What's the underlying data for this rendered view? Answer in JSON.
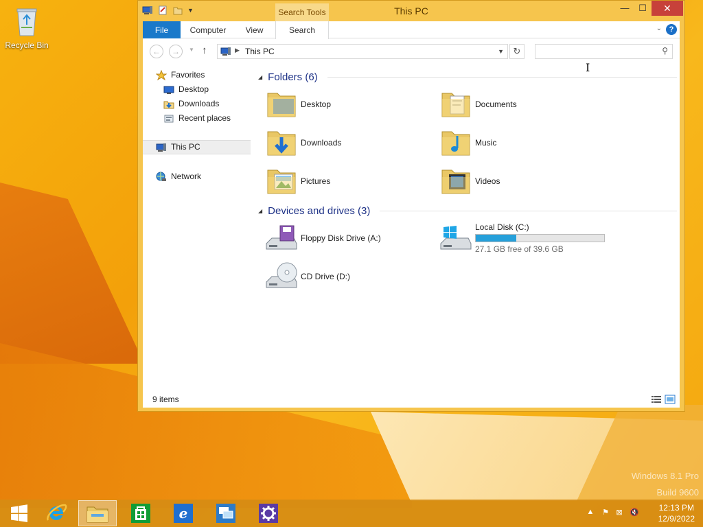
{
  "desktop": {
    "recycle_bin_label": "Recycle Bin",
    "watermark_line1": "Windows 8.1 Pro",
    "watermark_line2": "Build 9600"
  },
  "window": {
    "title": "This PC",
    "contextual_tab": "Search Tools",
    "ribbon_tabs": [
      "File",
      "Computer",
      "View",
      "Search"
    ],
    "address": {
      "path": "This PC"
    },
    "search": {
      "value": "",
      "placeholder": ""
    }
  },
  "navpane": {
    "items": [
      {
        "label": "Favorites",
        "icon": "star-icon"
      },
      {
        "label": "Desktop",
        "icon": "desktop-icon"
      },
      {
        "label": "Downloads",
        "icon": "downloads-icon"
      },
      {
        "label": "Recent places",
        "icon": "recent-places-icon"
      },
      {
        "label": "This PC",
        "icon": "this-pc-icon",
        "selected": true
      },
      {
        "label": "Network",
        "icon": "network-icon"
      }
    ]
  },
  "content": {
    "folders_header": "Folders (6)",
    "folders": [
      {
        "label": "Desktop",
        "icon": "desktop-folder-icon"
      },
      {
        "label": "Documents",
        "icon": "documents-folder-icon"
      },
      {
        "label": "Downloads",
        "icon": "downloads-folder-icon"
      },
      {
        "label": "Music",
        "icon": "music-folder-icon"
      },
      {
        "label": "Pictures",
        "icon": "pictures-folder-icon"
      },
      {
        "label": "Videos",
        "icon": "videos-folder-icon"
      }
    ],
    "drives_header": "Devices and drives (3)",
    "drives": [
      {
        "label": "Floppy Disk Drive (A:)",
        "icon": "floppy-drive-icon"
      },
      {
        "label": "Local Disk (C:)",
        "icon": "local-disk-icon",
        "free_text": "27.1 GB free of 39.6 GB",
        "used_fraction": 0.316
      },
      {
        "label": "CD Drive (D:)",
        "icon": "cd-drive-icon"
      }
    ]
  },
  "statusbar": {
    "items_text": "9 items"
  },
  "taskbar": {
    "buttons": [
      {
        "name": "start-button",
        "icon": "windows-logo-icon"
      },
      {
        "name": "internet-explorer-button",
        "icon": "ie-icon"
      },
      {
        "name": "file-explorer-button",
        "icon": "file-explorer-icon",
        "active": true
      },
      {
        "name": "store-button",
        "icon": "store-icon"
      },
      {
        "name": "ie-tile-button",
        "icon": "ie-tile-icon"
      },
      {
        "name": "remote-desktop-button",
        "icon": "remote-desktop-icon"
      },
      {
        "name": "settings-button",
        "icon": "gear-icon"
      }
    ],
    "clock_time": "12:13 PM",
    "clock_date": "12/9/2022"
  },
  "colors": {
    "accent": "#1979ca",
    "window_frame": "#f6c54d",
    "close": "#c7413a",
    "drive_bar": "#26a0da",
    "group_header": "#1e3287"
  }
}
